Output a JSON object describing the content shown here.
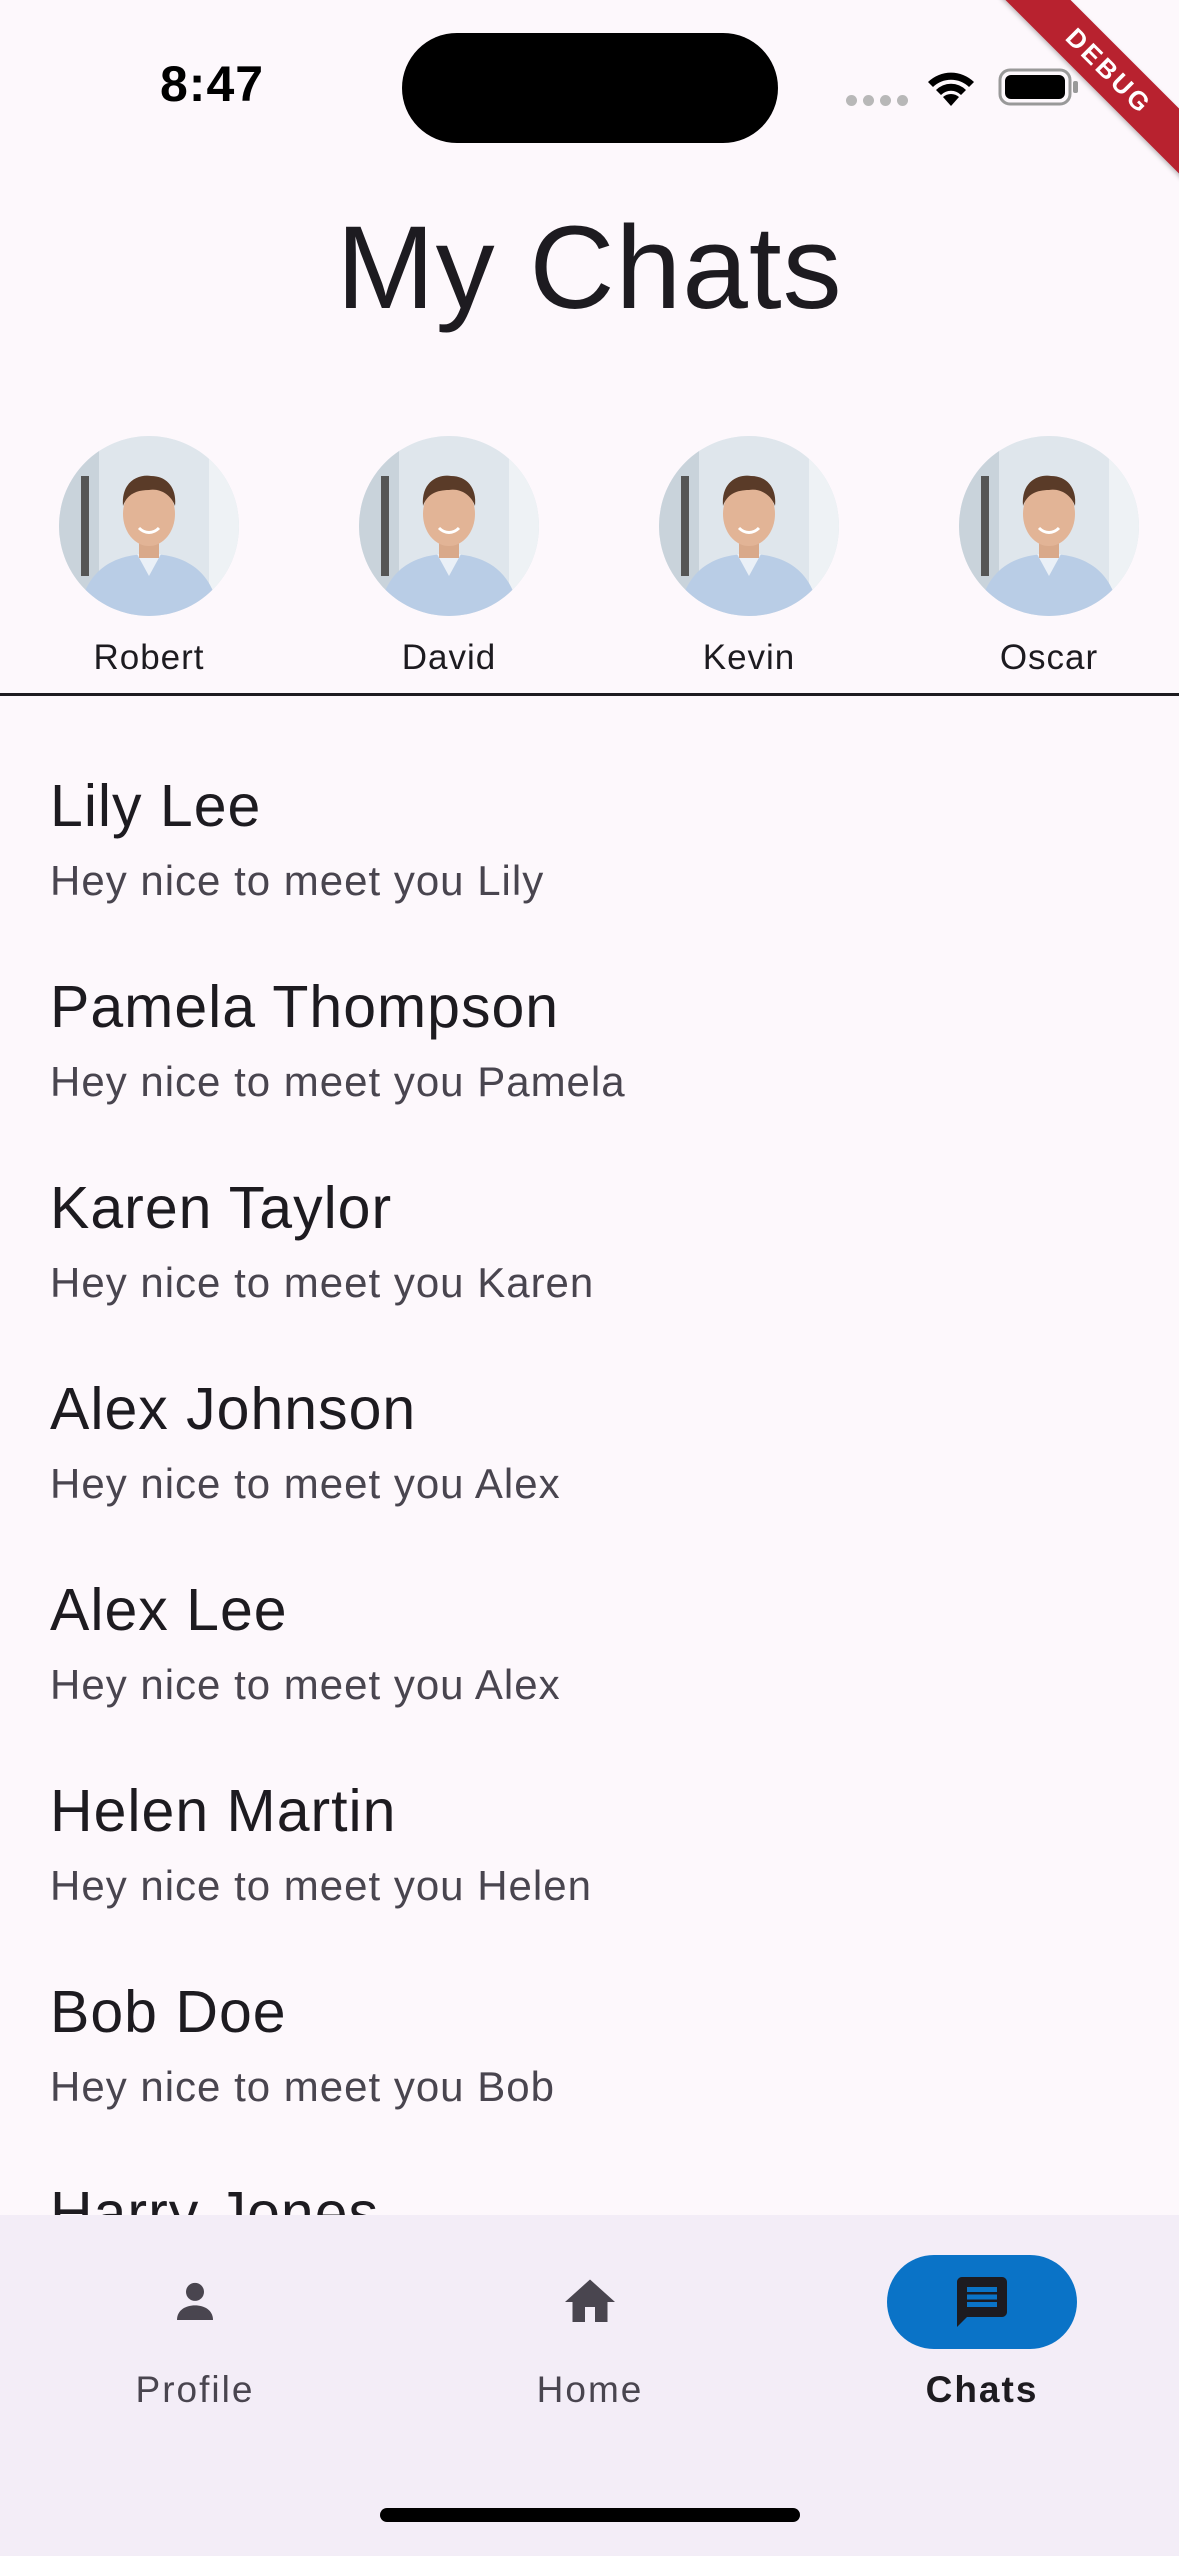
{
  "status_bar": {
    "time": "8:47",
    "debug_label": "DEBUG"
  },
  "header": {
    "title": "My Chats"
  },
  "stories": [
    {
      "name": "Robert"
    },
    {
      "name": "David"
    },
    {
      "name": "Kevin"
    },
    {
      "name": "Oscar"
    }
  ],
  "chats": [
    {
      "name": "Lily Lee",
      "preview": "Hey nice to meet you Lily"
    },
    {
      "name": "Pamela Thompson",
      "preview": "Hey nice to meet you Pamela"
    },
    {
      "name": "Karen Taylor",
      "preview": "Hey nice to meet you Karen"
    },
    {
      "name": "Alex Johnson",
      "preview": "Hey nice to meet you Alex"
    },
    {
      "name": "Alex Lee",
      "preview": "Hey nice to meet you Alex"
    },
    {
      "name": "Helen Martin",
      "preview": "Hey nice to meet you Helen"
    },
    {
      "name": "Bob Doe",
      "preview": "Hey nice to meet you Bob"
    },
    {
      "name": "Harry Jones",
      "preview": ""
    }
  ],
  "nav": {
    "items": [
      {
        "label": "Profile",
        "icon": "person-icon"
      },
      {
        "label": "Home",
        "icon": "home-icon"
      },
      {
        "label": "Chats",
        "icon": "chat-icon",
        "active": true
      }
    ],
    "active_color": "#0a73c7"
  }
}
